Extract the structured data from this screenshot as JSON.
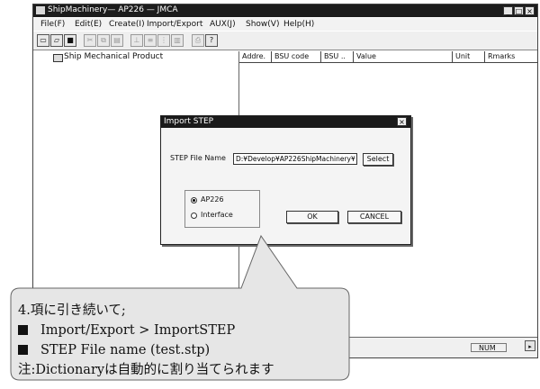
{
  "window": {
    "title": "ShipMachinery— AP226  — JMCA",
    "controls": {
      "minimize": "_",
      "maximize": "□",
      "close": "×"
    }
  },
  "menubar": {
    "items": [
      "File(F)",
      "Edit(E)",
      "Create(I)",
      "Import/Export",
      "AUX(J)",
      "Show(V)",
      "Help(H)"
    ]
  },
  "toolbar": {
    "buttons": [
      {
        "icon": "new-file-icon",
        "glyph": "▭"
      },
      {
        "icon": "open-folder-icon",
        "glyph": "▱"
      },
      {
        "icon": "save-icon",
        "glyph": "■"
      },
      {
        "icon": "cut-icon",
        "glyph": "✂"
      },
      {
        "icon": "copy-icon",
        "glyph": "⧉"
      },
      {
        "icon": "paste-icon",
        "glyph": "▤"
      },
      {
        "icon": "tool-icon-1",
        "glyph": "⊥"
      },
      {
        "icon": "tool-icon-2",
        "glyph": "≡"
      },
      {
        "icon": "tool-icon-3",
        "glyph": "⋮"
      },
      {
        "icon": "tool-icon-4",
        "glyph": "▥"
      },
      {
        "icon": "print-icon",
        "glyph": "⎙"
      },
      {
        "icon": "help-icon",
        "glyph": "?"
      }
    ]
  },
  "tree": {
    "root_label": "Ship Mechanical Product"
  },
  "table": {
    "columns": [
      "Addre.",
      "BSU code",
      "BSU ..",
      "Value",
      "Unit",
      "Rmarks"
    ]
  },
  "statusbar": {
    "num": "NUM",
    "scroll_glyph": "▸"
  },
  "dialog": {
    "title": "Import STEP",
    "close": "×",
    "step_file_label": "STEP File Name",
    "step_file_value": "D:¥Develop¥AP226ShipMachinery¥",
    "select_label": "Select",
    "options": [
      {
        "label": "AP226",
        "selected": true
      },
      {
        "label": "Interface",
        "selected": false
      }
    ],
    "ok_label": "OK",
    "cancel_label": "CANCEL"
  },
  "callout": {
    "line1": "4.項に引き続いて;",
    "line2": "Import/Export > ImportSTEP",
    "line3": "STEP File name  (test.stp)",
    "line4": "注:Dictionaryは自動的に割り当てられます"
  },
  "colors": {
    "titlebar": "#1c1c1c",
    "callout_fill": "#e6e6e6",
    "dialog_bg": "#f4f4f4"
  }
}
